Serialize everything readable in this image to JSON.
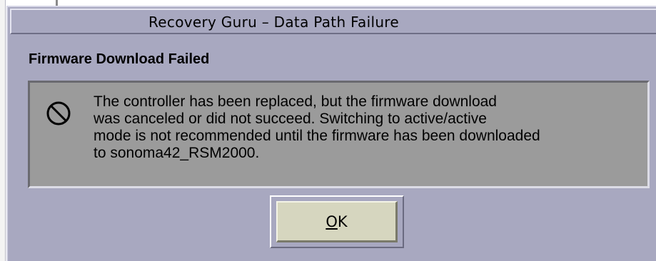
{
  "window": {
    "title": "Recovery Guru – Data Path Failure"
  },
  "dialog": {
    "heading": "Firmware Download Failed",
    "icon": "no-entry-icon",
    "message": "The controller has been replaced, but the firmware download\nwas canceled or did not succeed.  Switching to active/active\nmode is not recommended until the firmware has been downloaded\nto sonoma42_RSM2000.",
    "ok_mnemonic": "O",
    "ok_rest": "K"
  },
  "colors": {
    "dialog_bg": "#a8a8c0",
    "panel_bg": "#9b9b9b",
    "button_bg": "#d6d6bf"
  }
}
